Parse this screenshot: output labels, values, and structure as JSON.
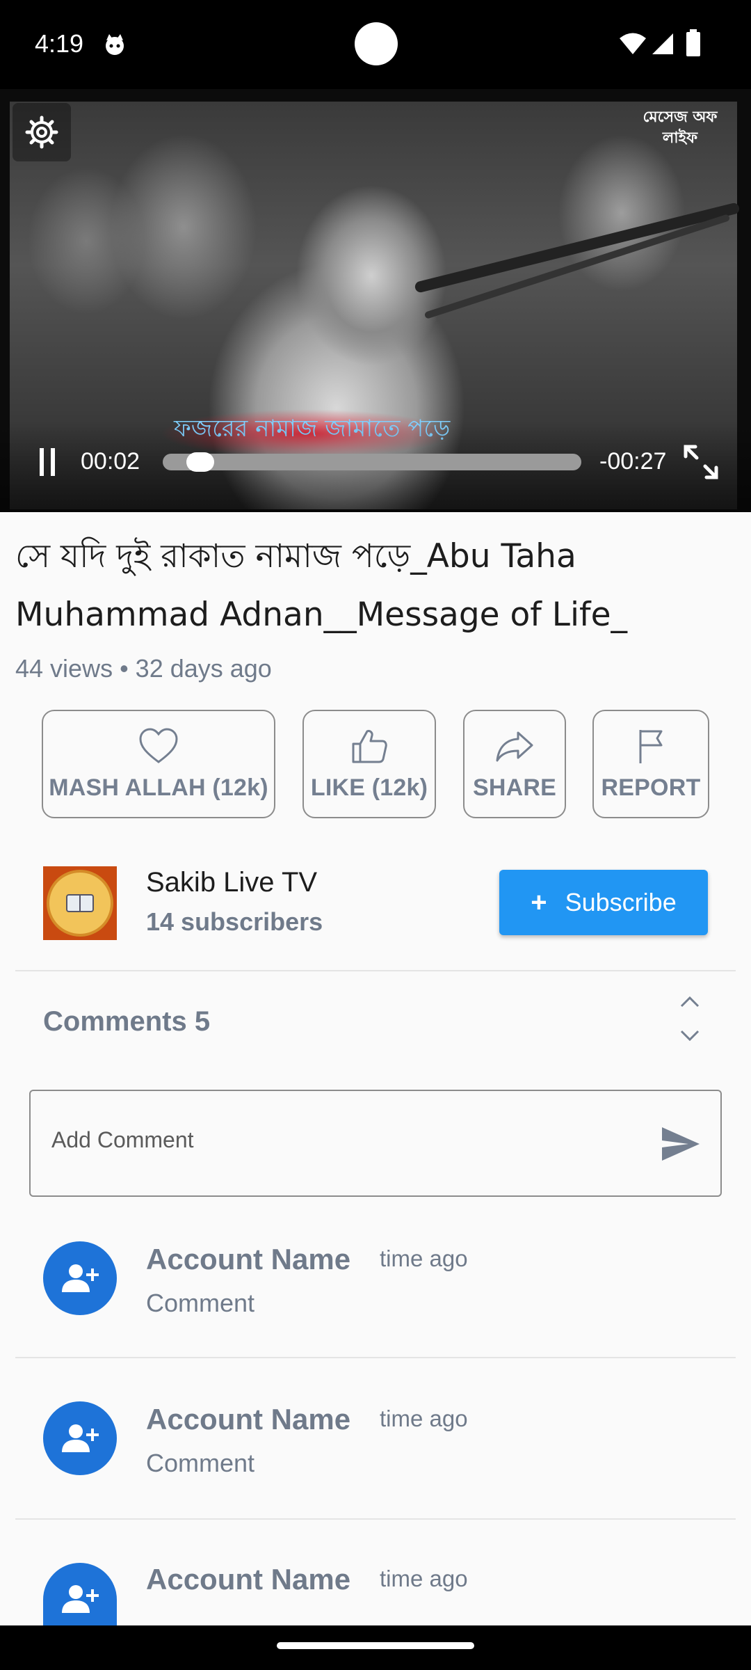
{
  "status_bar": {
    "time": "4:19",
    "icons": [
      "cat-notification-icon",
      "wifi-icon",
      "signal-icon",
      "battery-icon"
    ]
  },
  "video": {
    "subtitle": "ফজরের নামাজ জামাতে পড়ে",
    "watermark": "মেসেজ অফ লাইফ",
    "current_time": "00:02",
    "remaining_time": "-00:27",
    "progress": 0.06,
    "state": "playing"
  },
  "title": "সে যদি দুই রাকাত নামাজ পড়ে_Abu Taha Muhammad Adnan__Message of Life_",
  "meta": "44 views • 32 days ago",
  "actions": [
    {
      "label": "MASH ALLAH (12k)",
      "icon": "heart-icon"
    },
    {
      "label": "LIKE (12k)",
      "icon": "thumbs-up-icon"
    },
    {
      "label": "SHARE",
      "icon": "share-icon"
    },
    {
      "label": "REPORT",
      "icon": "flag-icon"
    }
  ],
  "channel": {
    "name": "Sakib Live TV",
    "subscribers": "14 subscribers",
    "subscribe_label": "Subscribe",
    "subscribe_icon": "+"
  },
  "comments": {
    "header": "Comments 5",
    "input_placeholder": "Add Comment",
    "items": [
      {
        "name": "Account Name",
        "time": "time ago",
        "text": "Comment"
      },
      {
        "name": "Account Name",
        "time": "time ago",
        "text": "Comment"
      },
      {
        "name": "Account Name",
        "time": "time ago",
        "text": ""
      }
    ]
  },
  "colors": {
    "accent": "#2196f3",
    "avatar": "#1e73d8",
    "muted_text": "#6f7a8a"
  }
}
